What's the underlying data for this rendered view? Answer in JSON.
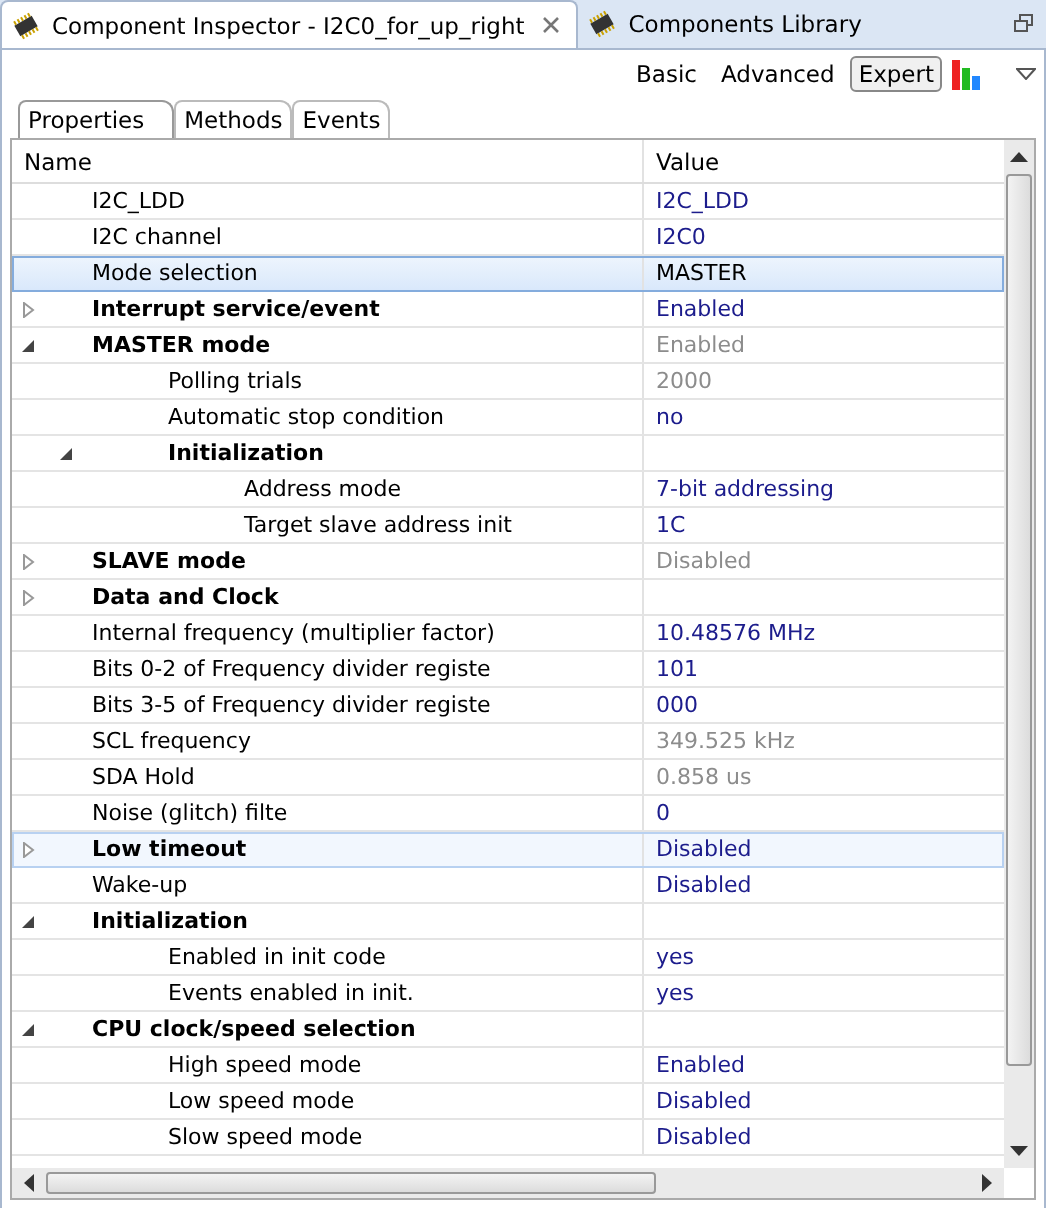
{
  "view_tabs": [
    {
      "title": "Component Inspector - I2C0_for_up_right",
      "selected": true,
      "closable": true
    },
    {
      "title": "Components Library",
      "selected": false,
      "closable": false
    }
  ],
  "modes": [
    {
      "label": "Basic",
      "selected": false
    },
    {
      "label": "Advanced",
      "selected": false
    },
    {
      "label": "Expert",
      "selected": true
    }
  ],
  "sub_tabs": [
    {
      "label": "Properties",
      "selected": true
    },
    {
      "label": "Methods",
      "selected": false
    },
    {
      "label": "Events",
      "selected": false
    }
  ],
  "table": {
    "columns": [
      "Name",
      "Value"
    ],
    "rows": [
      {
        "name": "I2C_LDD",
        "value": "I2C_LDD",
        "bold": false,
        "readonly": false
      },
      {
        "name": "I2C channel",
        "value": "I2C0",
        "bold": false,
        "readonly": false
      },
      {
        "name": "Mode selection",
        "value": "MASTER",
        "bold": false,
        "selected": true
      },
      {
        "name": "Interrupt service/event",
        "value": "Enabled",
        "bold": true,
        "readonly": false,
        "expanded": false
      },
      {
        "name": "MASTER mode",
        "value": "Enabled",
        "bold": true,
        "readonly": true,
        "expanded": true,
        "children": [
          {
            "name": "Polling trials",
            "value": "2000",
            "bold": false,
            "readonly": true
          },
          {
            "name": "Automatic stop condition",
            "value": "no",
            "bold": false,
            "readonly": false
          },
          {
            "name": "Initialization",
            "bold": true,
            "expanded": true,
            "children": [
              {
                "name": "Address mode",
                "value": "7-bit addressing",
                "bold": false,
                "readonly": false
              },
              {
                "name": "Target slave address init",
                "value": "1C",
                "bold": false,
                "readonly": false
              }
            ]
          }
        ]
      },
      {
        "name": "SLAVE mode",
        "value": "Disabled",
        "bold": true,
        "readonly": true,
        "expanded": false
      },
      {
        "name": "Data and Clock",
        "bold": true,
        "expanded": false
      },
      {
        "name": "Internal frequency (multiplier factor)",
        "value": "10.48576 MHz",
        "bold": false,
        "readonly": false
      },
      {
        "name": "Bits 0-2 of Frequency divider registe",
        "value": "101",
        "bold": false,
        "readonly": false
      },
      {
        "name": "Bits 3-5 of Frequency divider registe",
        "value": "000",
        "bold": false,
        "readonly": false
      },
      {
        "name": "SCL frequency",
        "value": "349.525 kHz",
        "bold": false,
        "readonly": true
      },
      {
        "name": "SDA Hold",
        "value": "0.858 us",
        "bold": false,
        "readonly": true
      },
      {
        "name": "Noise (glitch) filte",
        "value": "0",
        "bold": false,
        "readonly": false
      },
      {
        "name": "Low timeout",
        "value": "Disabled",
        "bold": true,
        "readonly": false,
        "expanded": false,
        "hovered": true
      },
      {
        "name": "Wake-up",
        "value": "Disabled",
        "bold": false,
        "readonly": false
      },
      {
        "name": "Initialization",
        "bold": true,
        "expanded": true,
        "children": [
          {
            "name": "Enabled in init code",
            "value": "yes",
            "bold": false,
            "readonly": false
          },
          {
            "name": "Events enabled in init.",
            "value": "yes",
            "bold": false,
            "readonly": false
          }
        ]
      },
      {
        "name": "CPU clock/speed selection",
        "bold": true,
        "expanded": true,
        "children": [
          {
            "name": "High speed mode",
            "value": "Enabled",
            "bold": false,
            "readonly": false
          },
          {
            "name": "Low speed mode",
            "value": "Disabled",
            "bold": false,
            "readonly": false
          },
          {
            "name": "Slow speed mode",
            "value": "Disabled",
            "bold": false,
            "readonly": false
          }
        ]
      }
    ]
  }
}
